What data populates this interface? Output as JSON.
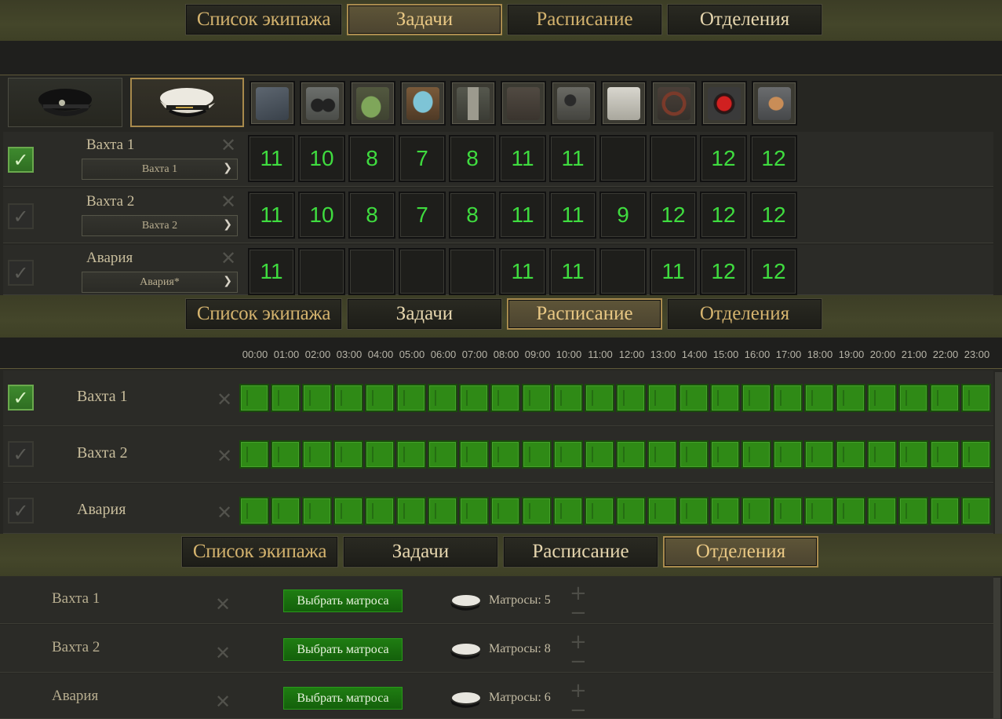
{
  "tabs": [
    "Список экипажа",
    "Задачи",
    "Расписание",
    "Отделения"
  ],
  "task_icons": [
    "torpedo-icon",
    "binoculars-icon",
    "mop-bucket-icon",
    "cooking-pot-icon",
    "periscope-icon",
    "bbc-radio-icon",
    "sonar-headphones-icon",
    "radio-receiver-icon",
    "helm-wheel-icon",
    "alarm-button-icon",
    "handprint-panel-icon"
  ],
  "captain_icons": [
    "officer-cap-black-icon",
    "officer-cap-white-icon"
  ],
  "watches": [
    {
      "name": "Вахта 1",
      "dropdown": "Вахта 1",
      "checked": true,
      "values": [
        "11",
        "10",
        "8",
        "7",
        "8",
        "11",
        "11",
        "",
        "",
        "12",
        "12"
      ]
    },
    {
      "name": "Вахта 2",
      "dropdown": "Вахта 2",
      "checked": false,
      "values": [
        "11",
        "10",
        "8",
        "7",
        "8",
        "11",
        "11",
        "9",
        "12",
        "12",
        "12"
      ]
    },
    {
      "name": "Авария",
      "dropdown": "Авария*",
      "checked": false,
      "values": [
        "11",
        "",
        "",
        "",
        "",
        "11",
        "11",
        "",
        "11",
        "12",
        "12"
      ]
    }
  ],
  "schedule": {
    "hours": [
      "00:00",
      "01:00",
      "02:00",
      "03:00",
      "04:00",
      "05:00",
      "06:00",
      "07:00",
      "08:00",
      "09:00",
      "10:00",
      "11:00",
      "12:00",
      "13:00",
      "14:00",
      "15:00",
      "16:00",
      "17:00",
      "18:00",
      "19:00",
      "20:00",
      "21:00",
      "22:00",
      "23:00"
    ],
    "rows": [
      {
        "name": "Вахта 1",
        "checked": true
      },
      {
        "name": "Вахта 2",
        "checked": false
      },
      {
        "name": "Авария",
        "checked": false
      }
    ]
  },
  "divisions": {
    "pick_label": "Выбрать матроса",
    "rows": [
      {
        "name": "Вахта 1",
        "sailors": "Матросы: 5"
      },
      {
        "name": "Вахта 2",
        "sailors": "Матросы: 8"
      },
      {
        "name": "Авария",
        "sailors": "Матросы: 6"
      }
    ]
  },
  "colors": {
    "accent": "#a98b4e",
    "value_green": "#3fdc3f",
    "slot_green": "#2f8a16",
    "pick_green": "#1f7d12"
  }
}
